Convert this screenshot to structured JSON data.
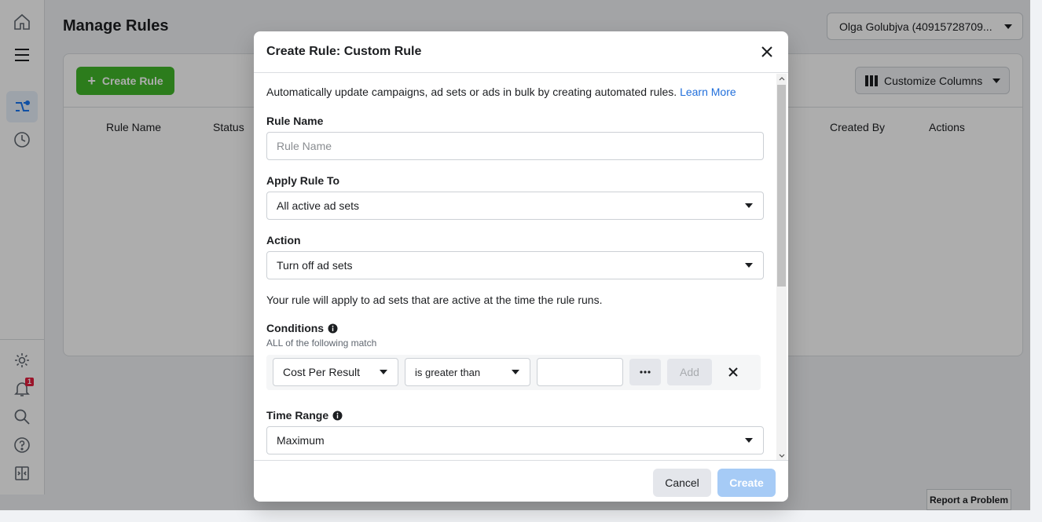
{
  "page": {
    "title": "Manage Rules",
    "account_label": "Olga Golubjva (40915728709..."
  },
  "toolbar": {
    "create_rule_label": "Create Rule",
    "customize_columns_label": "Customize Columns"
  },
  "table": {
    "columns": [
      "Rule Name",
      "Status",
      "Created By",
      "Actions"
    ]
  },
  "nav": {
    "icons": [
      "home-icon",
      "menu-icon",
      "automated-rules-icon",
      "history-icon",
      "settings-icon",
      "notifications-icon",
      "search-icon",
      "help-icon",
      "ads-reporting-icon"
    ],
    "notification_count": "1"
  },
  "report_problem_label": "Report a Problem",
  "modal": {
    "title": "Create Rule: Custom Rule",
    "intro_text": "Automatically update campaigns, ad sets or ads in bulk by creating automated rules.",
    "learn_more": "Learn More",
    "rule_name_label": "Rule Name",
    "rule_name_placeholder": "Rule Name",
    "apply_rule_to_label": "Apply Rule To",
    "apply_rule_to_value": "All active ad sets",
    "action_label": "Action",
    "action_value": "Turn off ad sets",
    "action_note": "Your rule will apply to ad sets that are active at the time the rule runs.",
    "conditions_label": "Conditions",
    "conditions_sub": "ALL of the following match",
    "condition": {
      "metric": "Cost Per Result",
      "operator": "is greater than",
      "value": "",
      "add_label": "Add"
    },
    "time_range_label": "Time Range",
    "time_range_value": "Maximum",
    "cancel_label": "Cancel",
    "create_label": "Create"
  }
}
